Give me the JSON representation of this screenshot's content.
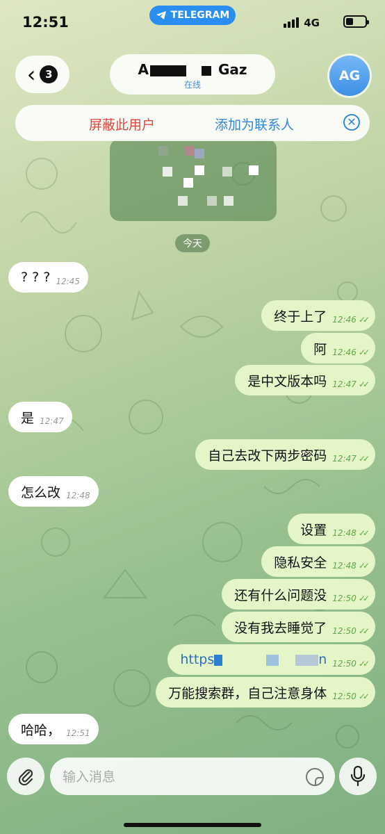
{
  "status_bar": {
    "time": "12:51",
    "pill": "TELEGRAM",
    "network": "4G"
  },
  "header": {
    "back_badge": "3",
    "name_start": "A",
    "name_end": "Gaz",
    "subtitle": "在线",
    "avatar_initials": "AG"
  },
  "action_bar": {
    "block": "屏蔽此用户",
    "add_contact": "添加为联系人"
  },
  "date_divider": "今天",
  "messages": [
    {
      "dir": "in",
      "text": "? ? ?",
      "time": "12:45"
    },
    {
      "dir": "out",
      "text": "终于上了",
      "time": "12:46"
    },
    {
      "dir": "out",
      "text": "阿",
      "time": "12:46"
    },
    {
      "dir": "out",
      "text": "是中文版本吗",
      "time": "12:47"
    },
    {
      "dir": "in",
      "text": "是",
      "time": "12:47"
    },
    {
      "dir": "out",
      "text": "自己去改下两步密码",
      "time": "12:47"
    },
    {
      "dir": "in",
      "text": "怎么改",
      "time": "12:48"
    },
    {
      "dir": "out",
      "text": "设置",
      "time": "12:48"
    },
    {
      "dir": "out",
      "text": "隐私安全",
      "time": "12:48"
    },
    {
      "dir": "out",
      "text": "还有什么问题没",
      "time": "12:50"
    },
    {
      "dir": "out",
      "text": "没有我去睡觉了",
      "time": "12:50"
    },
    {
      "dir": "out",
      "text": "https",
      "text_end": "n",
      "time": "12:50"
    },
    {
      "dir": "out",
      "text": "万能搜索群，自己注意身体",
      "time": "12:50"
    },
    {
      "dir": "in",
      "text": "哈哈，",
      "time": "12:51"
    }
  ],
  "composer": {
    "placeholder": "输入消息"
  },
  "icons": {
    "back": "chevron-left-icon",
    "close": "close-circle-icon",
    "attach": "paperclip-icon",
    "sticker": "sticker-icon",
    "mic": "microphone-icon",
    "telegram": "telegram-plane-icon"
  }
}
